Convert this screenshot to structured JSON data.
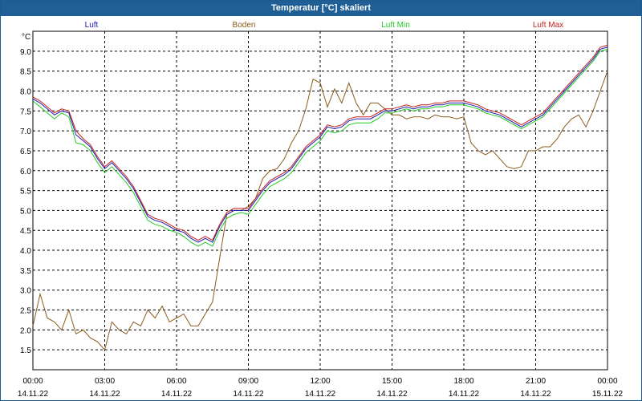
{
  "window": {
    "title": "Temperatur [°C] skaliert"
  },
  "chart_data": {
    "type": "line",
    "title": "Temperatur [°C] skaliert",
    "ylabel": "°C",
    "ylim": [
      1.0,
      9.5
    ],
    "y_ticks": [
      "9.0",
      "8.5",
      "8.0",
      "7.5",
      "7.0",
      "6.5",
      "6.0",
      "5.5",
      "5.0",
      "4.5",
      "4.0",
      "3.5",
      "3.0",
      "2.5",
      "2.0",
      "1.5"
    ],
    "xlim": [
      0,
      24
    ],
    "x_ticks": [
      {
        "time": "00:00",
        "date": "14.11.22"
      },
      {
        "time": "03:00",
        "date": "14.11.22"
      },
      {
        "time": "06:00",
        "date": "14.11.22"
      },
      {
        "time": "09:00",
        "date": "14.11.22"
      },
      {
        "time": "12:00",
        "date": "14.11.22"
      },
      {
        "time": "15:00",
        "date": "14.11.22"
      },
      {
        "time": "18:00",
        "date": "14.11.22"
      },
      {
        "time": "21:00",
        "date": "14.11.22"
      },
      {
        "time": "00:00",
        "date": "15.11.22"
      }
    ],
    "grid": true,
    "legend_position": "top",
    "series": [
      {
        "name": "Luft",
        "color": "#1a1ab0",
        "x": [
          0,
          0.3,
          0.6,
          0.9,
          1.2,
          1.5,
          1.8,
          2.1,
          2.4,
          2.7,
          3.0,
          3.3,
          3.6,
          3.9,
          4.2,
          4.5,
          4.8,
          5.1,
          5.4,
          5.7,
          6.0,
          6.3,
          6.6,
          6.9,
          7.2,
          7.5,
          7.8,
          8.1,
          8.4,
          8.7,
          9.0,
          9.3,
          9.6,
          9.9,
          10.2,
          10.5,
          10.8,
          11.1,
          11.4,
          11.7,
          12.0,
          12.3,
          12.6,
          12.9,
          13.2,
          13.5,
          13.8,
          14.1,
          14.4,
          14.7,
          15.0,
          15.3,
          15.6,
          15.9,
          16.2,
          16.5,
          16.8,
          17.1,
          17.4,
          17.7,
          18.0,
          18.3,
          18.6,
          18.9,
          19.2,
          19.5,
          19.8,
          20.1,
          20.4,
          20.7,
          21.0,
          21.3,
          21.6,
          21.9,
          22.2,
          22.5,
          22.8,
          23.1,
          23.4,
          23.7,
          24.0
        ],
        "y": [
          7.8,
          7.7,
          7.55,
          7.4,
          7.5,
          7.45,
          6.9,
          6.75,
          6.6,
          6.3,
          6.05,
          6.2,
          6.0,
          5.8,
          5.55,
          5.2,
          4.85,
          4.75,
          4.7,
          4.6,
          4.5,
          4.45,
          4.3,
          4.2,
          4.3,
          4.2,
          4.6,
          4.9,
          5.0,
          5.0,
          5.0,
          5.25,
          5.5,
          5.7,
          5.8,
          5.9,
          6.05,
          6.3,
          6.55,
          6.7,
          6.85,
          7.1,
          7.05,
          7.1,
          7.25,
          7.3,
          7.3,
          7.3,
          7.4,
          7.5,
          7.5,
          7.55,
          7.6,
          7.55,
          7.6,
          7.6,
          7.65,
          7.65,
          7.7,
          7.7,
          7.7,
          7.65,
          7.6,
          7.5,
          7.45,
          7.4,
          7.3,
          7.2,
          7.1,
          7.2,
          7.3,
          7.4,
          7.6,
          7.8,
          8.0,
          8.2,
          8.4,
          8.6,
          8.8,
          9.05,
          9.1
        ]
      },
      {
        "name": "Boden",
        "color": "#8a5a1a",
        "x": [
          0,
          0.3,
          0.6,
          0.9,
          1.2,
          1.5,
          1.8,
          2.1,
          2.4,
          2.7,
          3.0,
          3.3,
          3.6,
          3.9,
          4.2,
          4.5,
          4.8,
          5.1,
          5.4,
          5.7,
          6.0,
          6.3,
          6.6,
          6.9,
          7.2,
          7.5,
          7.8,
          8.1,
          8.4,
          8.7,
          9.0,
          9.3,
          9.6,
          9.9,
          10.2,
          10.5,
          10.8,
          11.1,
          11.4,
          11.7,
          12.0,
          12.3,
          12.6,
          12.9,
          13.2,
          13.5,
          13.8,
          14.1,
          14.4,
          14.7,
          15.0,
          15.3,
          15.6,
          15.9,
          16.2,
          16.5,
          16.8,
          17.1,
          17.4,
          17.7,
          18.0,
          18.3,
          18.6,
          18.9,
          19.2,
          19.5,
          19.8,
          20.1,
          20.4,
          20.7,
          21.0,
          21.3,
          21.6,
          21.9,
          22.2,
          22.5,
          22.8,
          23.1,
          23.4,
          23.7,
          24.0
        ],
        "y": [
          2.1,
          2.9,
          2.3,
          2.2,
          2.0,
          2.5,
          1.9,
          2.0,
          1.8,
          1.7,
          1.5,
          2.2,
          2.0,
          1.9,
          2.2,
          2.1,
          2.5,
          2.3,
          2.6,
          2.2,
          2.3,
          2.4,
          2.1,
          2.1,
          2.4,
          2.7,
          3.8,
          4.9,
          5.0,
          5.0,
          5.1,
          5.3,
          5.8,
          6.0,
          6.05,
          6.3,
          6.7,
          7.0,
          7.55,
          8.3,
          8.2,
          7.6,
          8.05,
          7.7,
          8.2,
          7.7,
          7.4,
          7.7,
          7.7,
          7.55,
          7.4,
          7.4,
          7.3,
          7.35,
          7.35,
          7.3,
          7.4,
          7.35,
          7.35,
          7.3,
          7.35,
          6.7,
          6.5,
          6.4,
          6.5,
          6.3,
          6.1,
          6.05,
          6.1,
          6.5,
          6.5,
          6.6,
          6.6,
          6.8,
          7.1,
          7.3,
          7.4,
          7.1,
          7.5,
          8.0,
          8.5
        ]
      },
      {
        "name": "Luft Min",
        "color": "#22c822",
        "x": [
          0,
          0.3,
          0.6,
          0.9,
          1.2,
          1.5,
          1.8,
          2.1,
          2.4,
          2.7,
          3.0,
          3.3,
          3.6,
          3.9,
          4.2,
          4.5,
          4.8,
          5.1,
          5.4,
          5.7,
          6.0,
          6.3,
          6.6,
          6.9,
          7.2,
          7.5,
          7.8,
          8.1,
          8.4,
          8.7,
          9.0,
          9.3,
          9.6,
          9.9,
          10.2,
          10.5,
          10.8,
          11.1,
          11.4,
          11.7,
          12.0,
          12.3,
          12.6,
          12.9,
          13.2,
          13.5,
          13.8,
          14.1,
          14.4,
          14.7,
          15.0,
          15.3,
          15.6,
          15.9,
          16.2,
          16.5,
          16.8,
          17.1,
          17.4,
          17.7,
          18.0,
          18.3,
          18.6,
          18.9,
          19.2,
          19.5,
          19.8,
          20.1,
          20.4,
          20.7,
          21.0,
          21.3,
          21.6,
          21.9,
          22.2,
          22.5,
          22.8,
          23.1,
          23.4,
          23.7,
          24.0
        ],
        "y": [
          7.75,
          7.6,
          7.45,
          7.3,
          7.45,
          7.35,
          6.7,
          6.65,
          6.5,
          6.2,
          5.95,
          6.1,
          5.9,
          5.7,
          5.45,
          5.1,
          4.75,
          4.65,
          4.6,
          4.5,
          4.45,
          4.35,
          4.2,
          4.1,
          4.2,
          4.1,
          4.5,
          4.8,
          4.9,
          4.95,
          4.9,
          5.15,
          5.4,
          5.6,
          5.7,
          5.8,
          5.95,
          6.2,
          6.45,
          6.6,
          6.75,
          7.0,
          6.95,
          7.0,
          7.15,
          7.2,
          7.2,
          7.2,
          7.3,
          7.45,
          7.45,
          7.5,
          7.55,
          7.5,
          7.55,
          7.55,
          7.6,
          7.6,
          7.65,
          7.65,
          7.65,
          7.6,
          7.55,
          7.45,
          7.4,
          7.35,
          7.25,
          7.15,
          7.05,
          7.15,
          7.25,
          7.35,
          7.55,
          7.75,
          7.95,
          8.15,
          8.35,
          8.55,
          8.75,
          9.0,
          9.05
        ]
      },
      {
        "name": "Luft Max",
        "color": "#c81e1e",
        "x": [
          0,
          0.3,
          0.6,
          0.9,
          1.2,
          1.5,
          1.8,
          2.1,
          2.4,
          2.7,
          3.0,
          3.3,
          3.6,
          3.9,
          4.2,
          4.5,
          4.8,
          5.1,
          5.4,
          5.7,
          6.0,
          6.3,
          6.6,
          6.9,
          7.2,
          7.5,
          7.8,
          8.1,
          8.4,
          8.7,
          9.0,
          9.3,
          9.6,
          9.9,
          10.2,
          10.5,
          10.8,
          11.1,
          11.4,
          11.7,
          12.0,
          12.3,
          12.6,
          12.9,
          13.2,
          13.5,
          13.8,
          14.1,
          14.4,
          14.7,
          15.0,
          15.3,
          15.6,
          15.9,
          16.2,
          16.5,
          16.8,
          17.1,
          17.4,
          17.7,
          18.0,
          18.3,
          18.6,
          18.9,
          19.2,
          19.5,
          19.8,
          20.1,
          20.4,
          20.7,
          21.0,
          21.3,
          21.6,
          21.9,
          22.2,
          22.5,
          22.8,
          23.1,
          23.4,
          23.7,
          24.0
        ],
        "y": [
          7.85,
          7.75,
          7.6,
          7.45,
          7.55,
          7.5,
          7.0,
          6.8,
          6.65,
          6.35,
          6.1,
          6.25,
          6.05,
          5.85,
          5.6,
          5.25,
          4.9,
          4.8,
          4.75,
          4.65,
          4.55,
          4.5,
          4.35,
          4.25,
          4.35,
          4.25,
          4.65,
          4.95,
          5.05,
          5.05,
          5.05,
          5.3,
          5.55,
          5.75,
          5.85,
          5.95,
          6.1,
          6.35,
          6.6,
          6.75,
          6.9,
          7.15,
          7.1,
          7.15,
          7.3,
          7.35,
          7.35,
          7.35,
          7.45,
          7.55,
          7.55,
          7.6,
          7.65,
          7.6,
          7.65,
          7.65,
          7.7,
          7.7,
          7.75,
          7.75,
          7.75,
          7.7,
          7.65,
          7.55,
          7.5,
          7.45,
          7.35,
          7.25,
          7.15,
          7.25,
          7.35,
          7.45,
          7.65,
          7.85,
          8.05,
          8.25,
          8.45,
          8.65,
          8.85,
          9.1,
          9.15
        ]
      }
    ]
  }
}
